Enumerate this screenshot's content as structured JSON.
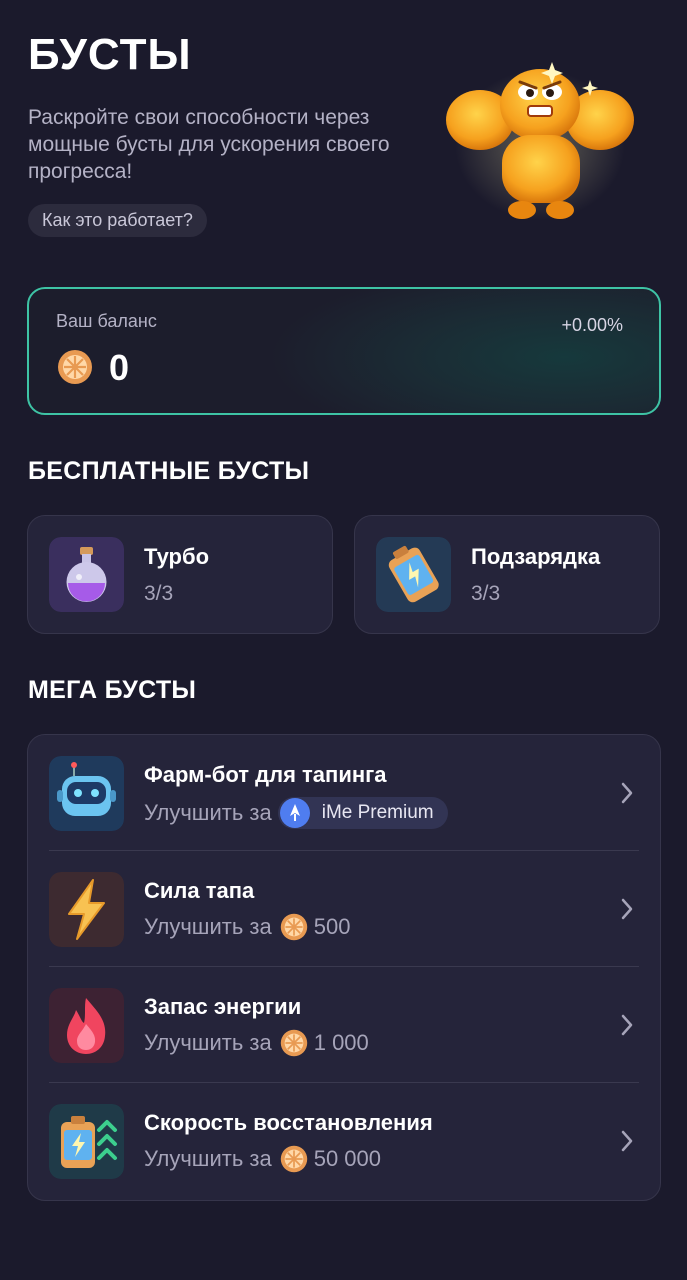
{
  "header": {
    "title": "БУСТЫ",
    "subtitle": "Раскройте свои способности через мощные бусты для ускорения своего прогресса!",
    "how_it_works": "Как это работает?"
  },
  "balance": {
    "label": "Ваш баланс",
    "value": "0",
    "change": "+0.00%"
  },
  "free_boosts": {
    "title": "БЕСПЛАТНЫЕ БУСТЫ",
    "items": [
      {
        "name": "Турбо",
        "count": "3/3",
        "icon": "potion-icon"
      },
      {
        "name": "Подзарядка",
        "count": "3/3",
        "icon": "battery-icon"
      }
    ]
  },
  "mega_boosts": {
    "title": "МЕГА БУСТЫ",
    "upgrade_prefix": "Улучшить за",
    "items": [
      {
        "name": "Фарм-бот для тапинга",
        "price": "iMe Premium",
        "icon": "robot-icon"
      },
      {
        "name": "Сила тапа",
        "price": "500",
        "icon": "lightning-icon"
      },
      {
        "name": "Запас энергии",
        "price": "1 000",
        "icon": "flame-icon"
      },
      {
        "name": "Скорость восстановления",
        "price": "50 000",
        "icon": "battery-speed-icon"
      }
    ]
  },
  "colors": {
    "background": "#1b1a2c",
    "card": "#25243a",
    "accent_border": "#3ec3a5",
    "coin": "#f2a25b"
  }
}
